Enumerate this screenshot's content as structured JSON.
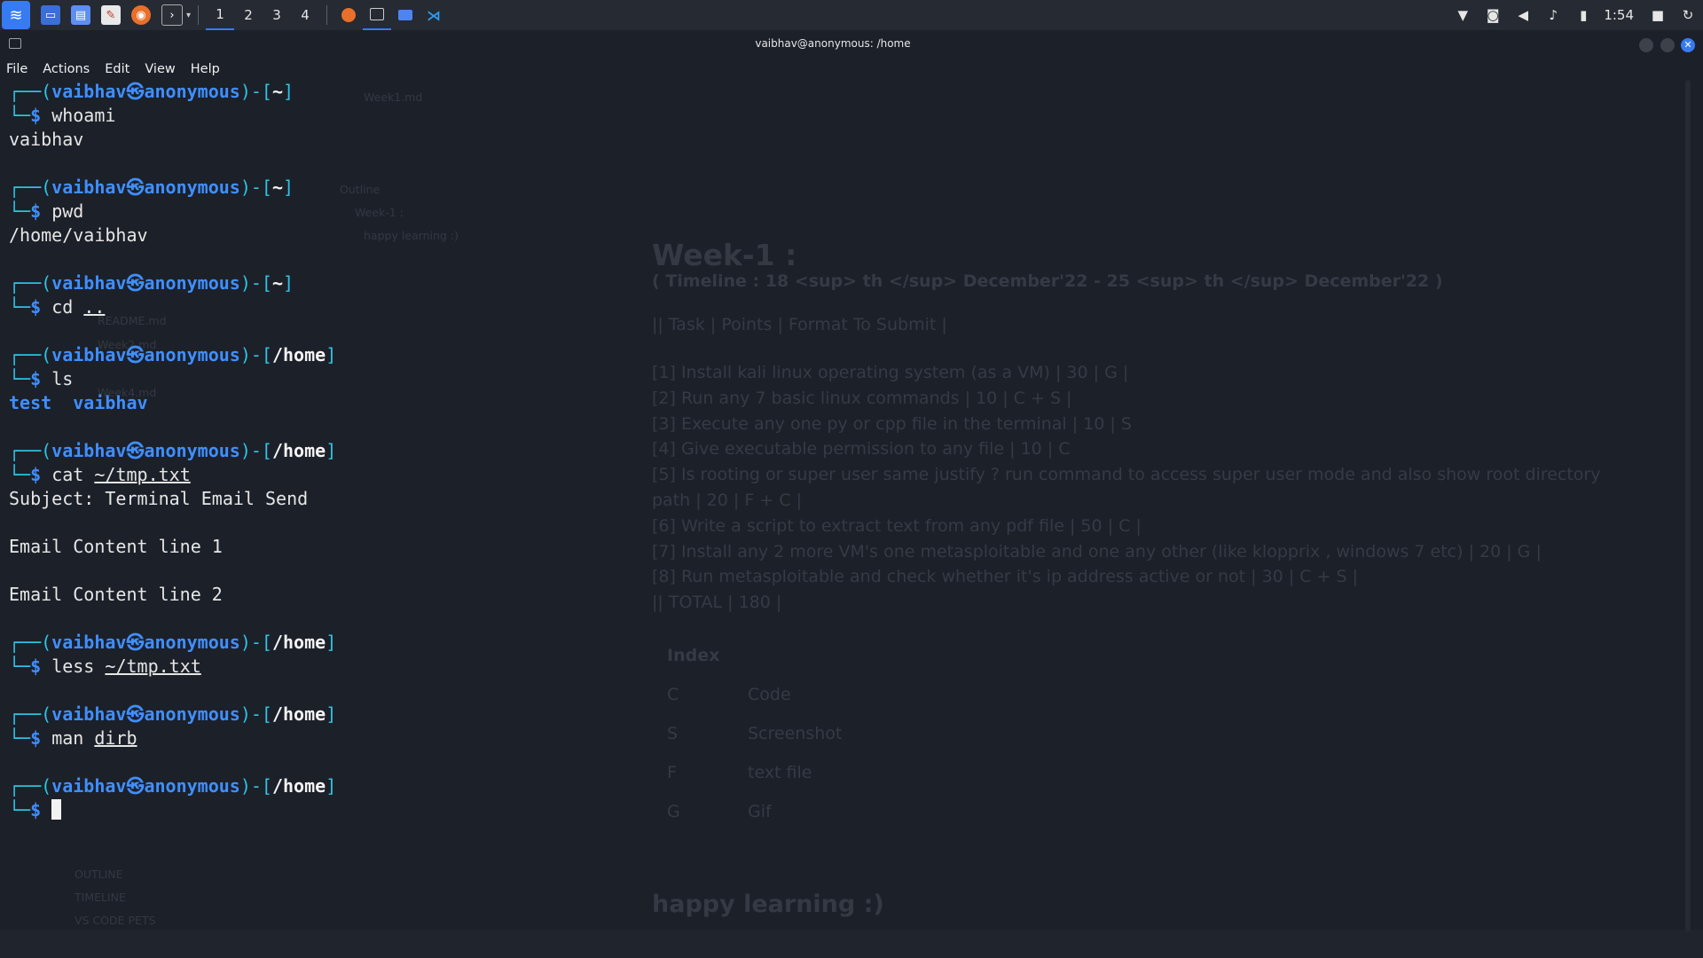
{
  "taskbar": {
    "workspaces": [
      "1",
      "2",
      "3",
      "4"
    ],
    "active_workspace": "1",
    "clock": "1:54"
  },
  "window": {
    "title": "vaibhav@anonymous: /home",
    "menu": [
      "File",
      "Actions",
      "Edit",
      "View",
      "Help"
    ]
  },
  "prompt": {
    "user": "vaibhav",
    "host": "anonymous",
    "skull": "㉿",
    "dollar": "$"
  },
  "session": [
    {
      "dir": "~",
      "command": "whoami",
      "arg": "",
      "output": [
        "vaibhav"
      ]
    },
    {
      "dir": "~",
      "command": "pwd",
      "arg": "",
      "output": [
        "/home/vaibhav"
      ]
    },
    {
      "dir": "~",
      "command": "cd",
      "arg": "..",
      "output": []
    },
    {
      "dir": "/home",
      "command": "ls",
      "arg": "",
      "ls_items": [
        "test",
        "vaibhav"
      ]
    },
    {
      "dir": "/home",
      "command": "cat",
      "arg": "~/tmp.txt",
      "output": [
        "Subject: Terminal Email Send",
        "",
        "Email Content line 1",
        "",
        "Email Content line 2"
      ]
    },
    {
      "dir": "/home",
      "command": "less",
      "arg": "~/tmp.txt",
      "output": []
    },
    {
      "dir": "/home",
      "command": "man",
      "arg": "dirb",
      "output": []
    },
    {
      "dir": "/home",
      "command": "",
      "arg": "",
      "output": []
    }
  ],
  "background_ghost": {
    "doc_title": "Week-1 :",
    "timeline": "( Timeline : 18 <sup> th </sup>  December'22 - 25 <sup> th </sup>  December'22 )",
    "table_lines": [
      "|| Task               | Points    |        Format To Submit     |",
      "[1] Install kali linux operating system (as a VM)  | 30  |   G     |",
      "[2] Run any 7 basic linux commands | 10  |             C + S       |",
      "[3] Execute any one py or cpp file in the terminal   | 10  |                 S",
      "[4] Give executable permission to any file | 10 | C",
      "[5] Is rooting or super user same justify ? run command to access super user mode and also show root directory",
      "path  | 20  |       F + C       |",
      "[6] Write a script to extract text from any pdf file | 50 | C |",
      "[7] Install any 2 more VM's one metasploitable and one any other (like klopprix , windows 7 etc)  | 20  |        G      |",
      "[8] Run metasploitable and check whether it's ip address active or not  | 30  |        C + S        |",
      "|| TOTAL  | 180        |"
    ],
    "index_title": "Index",
    "index": [
      [
        "C",
        "Code"
      ],
      [
        "S",
        "Screenshot"
      ],
      [
        "F",
        "text file"
      ],
      [
        "G",
        "Gif"
      ]
    ],
    "footer": "happy learning :)",
    "sidebar": [
      "Week1.md",
      "Outline",
      "Week-1 :",
      "happy learning :)",
      "README.md",
      "Week2.md",
      "Week4.md",
      "OUTLINE",
      "TIMELINE",
      "VS CODE PETS"
    ]
  },
  "colors": {
    "accent": "#367bf0",
    "prompt_user": "#3f8fff",
    "prompt_frame": "#2ec5e5",
    "background": "#1c2029",
    "taskbar": "#262a33"
  }
}
